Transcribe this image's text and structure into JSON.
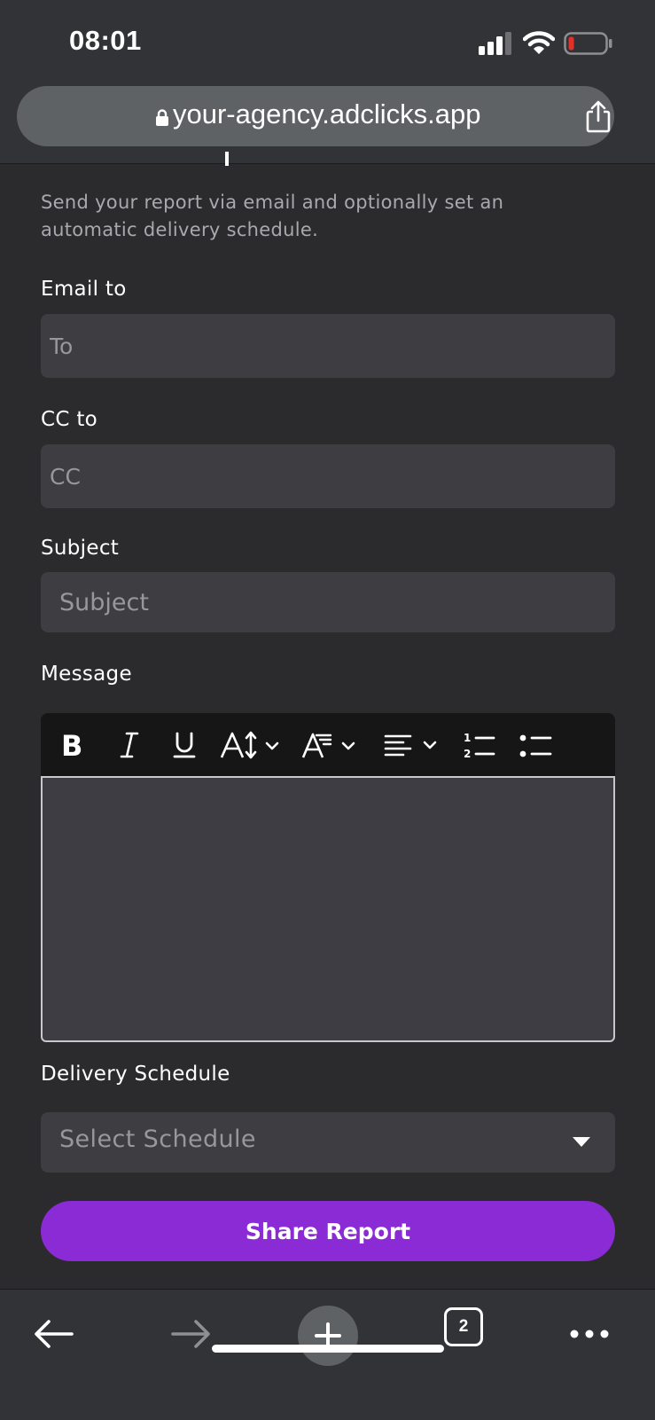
{
  "status_bar": {
    "time": "08:01"
  },
  "browser": {
    "url": "your-agency.adclicks.app",
    "tab_count": "2"
  },
  "form": {
    "description": "Send your report via email and optionally set an automatic delivery schedule.",
    "email_to": {
      "label": "Email to",
      "placeholder": "To"
    },
    "cc_to": {
      "label": "CC to",
      "placeholder": "CC"
    },
    "subject": {
      "label": "Subject",
      "placeholder": "Subject"
    },
    "message": {
      "label": "Message",
      "toolbar": [
        "bold-icon",
        "italic-icon",
        "underline-icon",
        "font-size-icon",
        "font-style-icon",
        "align-icon",
        "ordered-list-icon",
        "bullet-list-icon"
      ]
    },
    "delivery_schedule": {
      "label": "Delivery Schedule",
      "placeholder": "Select Schedule"
    },
    "submit_label": "Share Report"
  },
  "colors": {
    "accent": "#8a2bd6",
    "background": "#2b2b2d",
    "field": "#3d3d42",
    "battery_low": "#e3312a"
  }
}
